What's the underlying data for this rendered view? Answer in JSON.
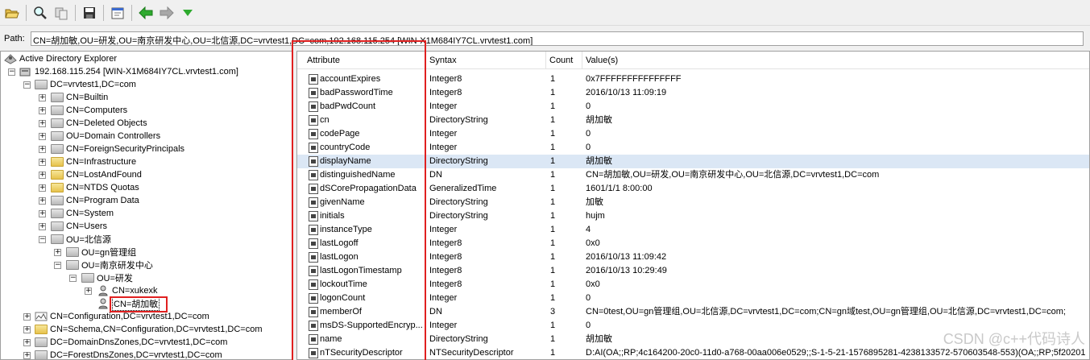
{
  "toolbar": {
    "buttons": [
      {
        "name": "open-icon"
      },
      {
        "name": "search-icon"
      },
      {
        "name": "compare-icon"
      },
      {
        "name": "save-icon"
      },
      {
        "name": "properties-icon"
      },
      {
        "name": "back-icon"
      },
      {
        "name": "forward-icon"
      },
      {
        "name": "dropdown-icon"
      }
    ]
  },
  "path": {
    "label": "Path:",
    "value": "CN=胡加敏,OU=研发,OU=南京研发中心,OU=北信源,DC=vrvtest1,DC=com,192.168.115.254 [WIN-X1M684IY7CL.vrvtest1.com]"
  },
  "tree": {
    "root": "Active Directory Explorer",
    "server": "192.168.115.254 [WIN-X1M684IY7CL.vrvtest1.com]",
    "domain": "DC=vrvtest1,DC=com",
    "children": [
      "CN=Builtin",
      "CN=Computers",
      "CN=Deleted Objects",
      "OU=Domain Controllers",
      "CN=ForeignSecurityPrincipals",
      "CN=Infrastructure",
      "CN=LostAndFound",
      "CN=NTDS Quotas",
      "CN=Program Data",
      "CN=System",
      "CN=Users"
    ],
    "ou_root": "OU=北信源",
    "ou_gn": "OU=gn管理组",
    "ou_nj": "OU=南京研发中心",
    "ou_rd": "OU=研发",
    "user1": "CN=xukexk",
    "user2": "CN=胡加敏",
    "config": "CN=Configuration,DC=vrvtest1,DC=com",
    "schema": "CN=Schema,CN=Configuration,DC=vrvtest1,DC=com",
    "domaindns": "DC=DomainDnsZones,DC=vrvtest1,DC=com",
    "forestdns": "DC=ForestDnsZones,DC=vrvtest1,DC=com"
  },
  "grid": {
    "columns": [
      "Attribute",
      "Syntax",
      "Count",
      "Value(s)"
    ],
    "rows": [
      [
        "accountExpires",
        "Integer8",
        "1",
        "0x7FFFFFFFFFFFFFFF"
      ],
      [
        "badPasswordTime",
        "Integer8",
        "1",
        "2016/10/13 11:09:19"
      ],
      [
        "badPwdCount",
        "Integer",
        "1",
        "0"
      ],
      [
        "cn",
        "DirectoryString",
        "1",
        "胡加敏"
      ],
      [
        "codePage",
        "Integer",
        "1",
        "0"
      ],
      [
        "countryCode",
        "Integer",
        "1",
        "0"
      ],
      [
        "displayName",
        "DirectoryString",
        "1",
        "胡加敏"
      ],
      [
        "distinguishedName",
        "DN",
        "1",
        "CN=胡加敏,OU=研发,OU=南京研发中心,OU=北信源,DC=vrvtest1,DC=com"
      ],
      [
        "dSCorePropagationData",
        "GeneralizedTime",
        "1",
        "1601/1/1 8:00:00"
      ],
      [
        "givenName",
        "DirectoryString",
        "1",
        "加敏"
      ],
      [
        "initials",
        "DirectoryString",
        "1",
        "hujm"
      ],
      [
        "instanceType",
        "Integer",
        "1",
        "4"
      ],
      [
        "lastLogoff",
        "Integer8",
        "1",
        "0x0"
      ],
      [
        "lastLogon",
        "Integer8",
        "1",
        "2016/10/13 11:09:42"
      ],
      [
        "lastLogonTimestamp",
        "Integer8",
        "1",
        "2016/10/13 10:29:49"
      ],
      [
        "lockoutTime",
        "Integer8",
        "1",
        "0x0"
      ],
      [
        "logonCount",
        "Integer",
        "1",
        "0"
      ],
      [
        "memberOf",
        "DN",
        "3",
        "CN=0test,OU=gn管理组,OU=北信源,DC=vrvtest1,DC=com;CN=gn域test,OU=gn管理组,OU=北信源,DC=vrvtest1,DC=com;"
      ],
      [
        "msDS-SupportedEncryp...",
        "Integer",
        "1",
        "0"
      ],
      [
        "name",
        "DirectoryString",
        "1",
        "胡加敏"
      ],
      [
        "nTSecurityDescriptor",
        "NTSecurityDescriptor",
        "1",
        "D:AI(OA;;RP;4c164200-20c0-11d0-a768-00aa006e0529;;S-1-5-21-1576895281-4238133572-570603548-553)(OA;;RP;5f20201"
      ]
    ],
    "selected_row": 6
  },
  "watermark": "CSDN @c++代码诗人",
  "colors": {
    "highlight_box": "#e02020",
    "selected_row": "#dbe7f5"
  }
}
